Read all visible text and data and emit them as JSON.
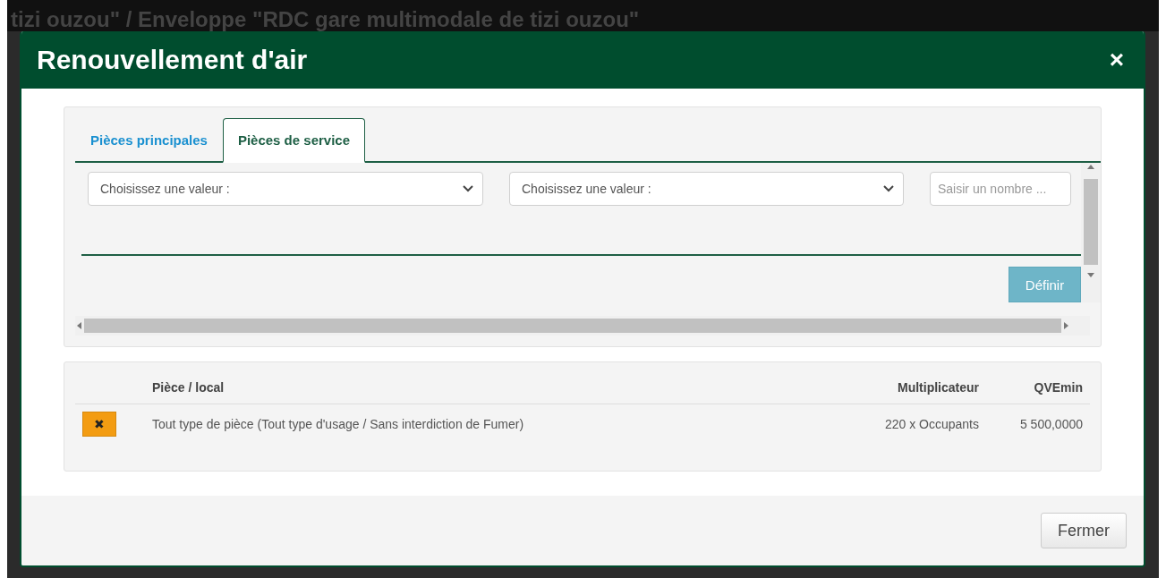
{
  "backdrop_title": "tizi ouzou\" / Enveloppe \"RDC gare multimodale de tizi ouzou\"",
  "dialog": {
    "title": "Renouvellement d'air",
    "close": "×"
  },
  "tabs": [
    {
      "label": "Pièces principales",
      "selected": false
    },
    {
      "label": "Pièces de service",
      "selected": true
    }
  ],
  "form": {
    "selects": [
      {
        "placeholder": "Choisissez une valeur :"
      },
      {
        "placeholder": "Choisissez une valeur :"
      }
    ],
    "number": {
      "placeholder": "Saisir un nombre ..."
    },
    "submit": "Définir"
  },
  "table": {
    "columns": [
      "",
      "Pièce / local",
      "Multiplicateur",
      "QVEmin"
    ],
    "rows": [
      {
        "delete": "✖",
        "piece": "Tout type de pièce (Tout type d'usage / Sans interdiction de Fumer)",
        "multiplicateur": "220 x Occupants",
        "qvemin": "5 500,0000"
      }
    ]
  },
  "footer": {
    "close_button": "Fermer"
  }
}
